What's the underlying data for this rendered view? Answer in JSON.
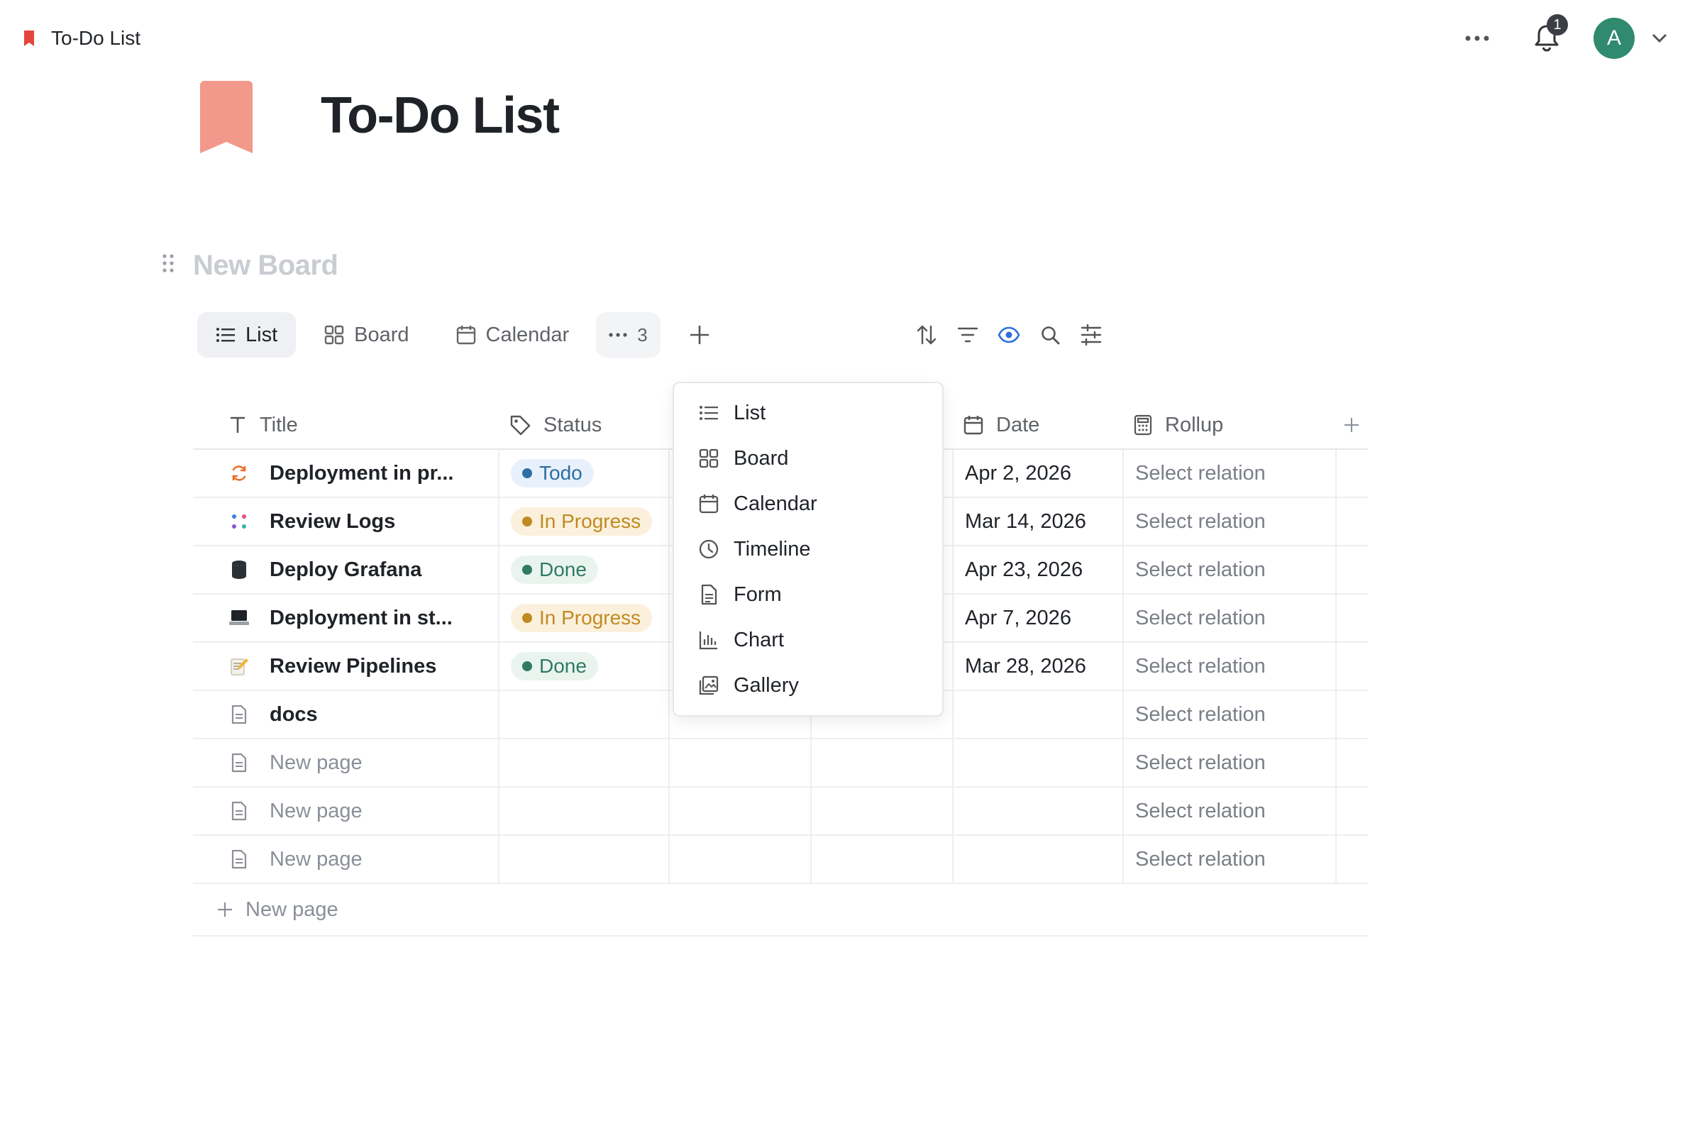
{
  "breadcrumb": {
    "title": "To-Do List"
  },
  "notifications": {
    "count": "1"
  },
  "user": {
    "initial": "A"
  },
  "page": {
    "title": "To-Do List",
    "board_name": "New Board"
  },
  "colors": {
    "accent": "#2f6fdd",
    "page_icon": "#f2998c",
    "crumb_icon": "#e3463c",
    "avatar": "#2f8a6e"
  },
  "views": {
    "tabs": [
      {
        "label": "List",
        "icon": "list-icon",
        "active": true
      },
      {
        "label": "Board",
        "icon": "board-icon",
        "active": false
      },
      {
        "label": "Calendar",
        "icon": "calendar-icon",
        "active": false
      }
    ],
    "more_count": "3"
  },
  "table": {
    "columns": [
      {
        "label": "Title",
        "icon": "text-icon"
      },
      {
        "label": "Status",
        "icon": "tag-icon"
      },
      {
        "label": "Date",
        "icon": "calendar-icon"
      },
      {
        "label": "Rollup",
        "icon": "calculator-icon"
      }
    ],
    "rows": [
      {
        "title": "Deployment in pr...",
        "icon": "refresh-icon",
        "status": "Todo",
        "status_kind": "todo",
        "date": "Apr 2, 2026",
        "rollup": "Select relation"
      },
      {
        "title": "Review Logs",
        "icon": "dots-grid-icon",
        "status": "In Progress",
        "status_kind": "progress",
        "date": "Mar 14, 2026",
        "rollup": "Select relation"
      },
      {
        "title": "Deploy Grafana",
        "icon": "database-icon",
        "status": "Done",
        "status_kind": "done",
        "date": "Apr 23, 2026",
        "rollup": "Select relation"
      },
      {
        "title": "Deployment in st...",
        "icon": "laptop-icon",
        "status": "In Progress",
        "status_kind": "progress",
        "date": "Apr 7, 2026",
        "rollup": "Select relation"
      },
      {
        "title": "Review Pipelines",
        "icon": "memo-icon",
        "status": "Done",
        "status_kind": "done",
        "date": "Mar 28, 2026",
        "rollup": "Select relation"
      },
      {
        "title": "docs",
        "icon": "page-icon",
        "status": "",
        "status_kind": "",
        "date": "",
        "rollup": "Select relation"
      },
      {
        "title": "New page",
        "icon": "page-icon",
        "status": "",
        "status_kind": "",
        "date": "",
        "rollup": "Select relation",
        "placeholder": true
      },
      {
        "title": "New page",
        "icon": "page-icon",
        "status": "",
        "status_kind": "",
        "date": "",
        "rollup": "Select relation",
        "placeholder": true
      },
      {
        "title": "New page",
        "icon": "page-icon",
        "status": "",
        "status_kind": "",
        "date": "",
        "rollup": "Select relation",
        "placeholder": true
      }
    ],
    "new_page_label": "New page"
  },
  "dropdown": {
    "items": [
      {
        "label": "List",
        "icon": "list-icon"
      },
      {
        "label": "Board",
        "icon": "board-icon"
      },
      {
        "label": "Calendar",
        "icon": "calendar-icon"
      },
      {
        "label": "Timeline",
        "icon": "clock-icon"
      },
      {
        "label": "Form",
        "icon": "form-icon"
      },
      {
        "label": "Chart",
        "icon": "chart-icon"
      },
      {
        "label": "Gallery",
        "icon": "gallery-icon"
      }
    ]
  }
}
